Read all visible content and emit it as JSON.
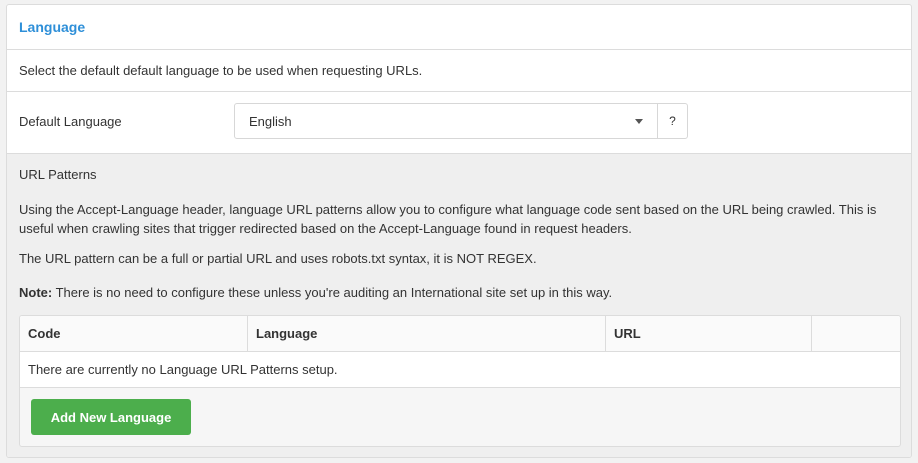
{
  "panel": {
    "title": "Language",
    "description": "Select the default default language to be used when requesting URLs."
  },
  "default_language": {
    "label": "Default Language",
    "selected": "English",
    "help_label": "?"
  },
  "url_patterns": {
    "heading": "URL Patterns",
    "paragraph1": "Using the Accept-Language header, language URL patterns allow you to configure what language code sent based on the URL being crawled. This is useful when crawling sites that trigger redirected based on the Accept-Language found in request headers.",
    "paragraph2": "The URL pattern can be a full or partial URL and uses robots.txt syntax, it is NOT REGEX.",
    "note_label": "Note:",
    "note_text": " There is no need to configure these unless you're auditing an International site set up in this way.",
    "table": {
      "columns": [
        "Code",
        "Language",
        "URL",
        ""
      ],
      "empty_message": "There are currently no Language URL Patterns setup."
    },
    "add_button": "Add New Language"
  },
  "colors": {
    "title": "#2e8fd8",
    "add_button": "#4cae4c"
  }
}
